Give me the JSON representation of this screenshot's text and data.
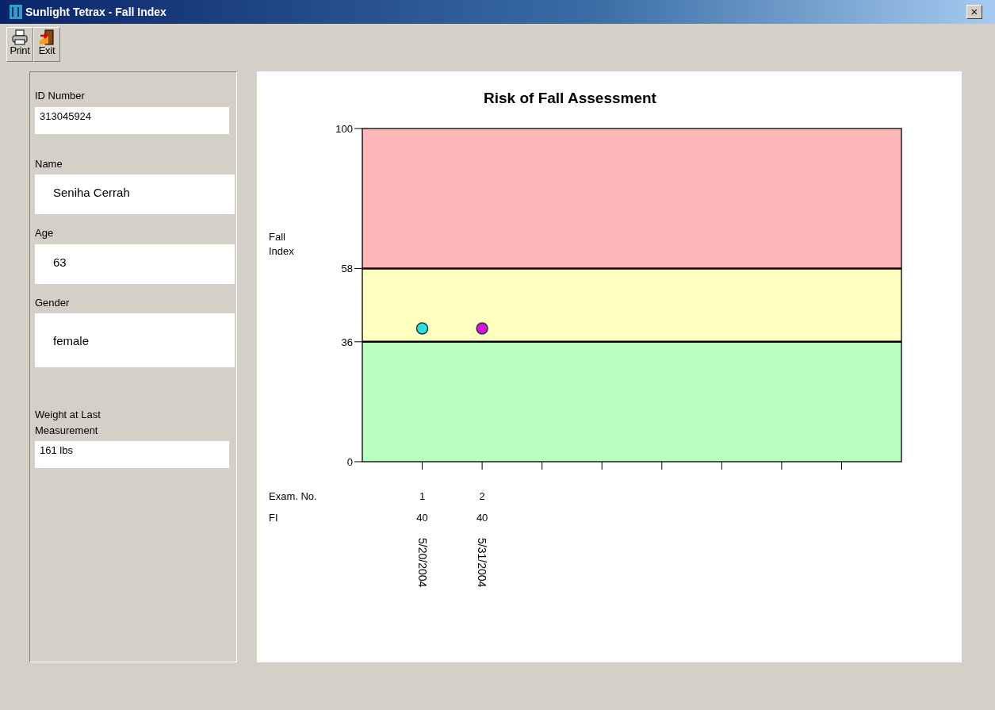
{
  "window": {
    "title": "Sunlight Tetrax - Fall Index",
    "close": "×"
  },
  "toolbar": [
    {
      "label": "Print",
      "kind": "print"
    },
    {
      "label": "Exit",
      "kind": "exit"
    }
  ],
  "patient_fields": [
    {
      "label": "ID Number",
      "value": "313045924",
      "kind": "compact"
    },
    {
      "label": "Name",
      "value": "Seniha Cerrah",
      "kind": "roomy"
    },
    {
      "label": "Age",
      "value": "63",
      "kind": "roomy"
    },
    {
      "label": "Gender",
      "value": "female",
      "kind": "tall"
    },
    {
      "label": "Weight at Last Measurement",
      "value": "161 lbs",
      "kind": "compact"
    }
  ],
  "chart": {
    "row_labels": [
      "Exam. No.",
      "FI"
    ],
    "exams": [
      {
        "fi": "40",
        "date": "5/20/2004"
      },
      {
        "fi": "40",
        "date": "5/31/2004"
      }
    ],
    "chart_data": {
      "type": "scatter",
      "title": "Risk of Fall Assessment",
      "ylabel": "Fall Index",
      "x": [
        1,
        2
      ],
      "xlim": [
        0,
        9
      ],
      "ylim": [
        0,
        100
      ],
      "xticks": [
        1,
        2
      ],
      "yticks": [
        0,
        36,
        58,
        100
      ],
      "series": [
        {
          "color": "#33dddd",
          "values": [
            40,
            null
          ]
        },
        {
          "color": "#dd11dd",
          "values": [
            null,
            40
          ]
        }
      ],
      "bands": [
        {
          "axis": "y",
          "from": 58,
          "to": 100,
          "color": "#ffb7ba"
        },
        {
          "axis": "y",
          "from": 36,
          "to": 58,
          "color": "#ffffc0"
        },
        {
          "axis": "y",
          "from": 0,
          "to": 36,
          "color": "#bbffbf"
        }
      ]
    }
  }
}
